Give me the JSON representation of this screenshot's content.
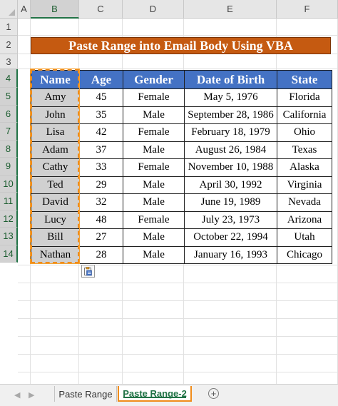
{
  "columns": [
    "A",
    "B",
    "C",
    "D",
    "E",
    "F"
  ],
  "rows": [
    "1",
    "2",
    "3",
    "4",
    "5",
    "6",
    "7",
    "8",
    "9",
    "10",
    "11",
    "12",
    "13",
    "14"
  ],
  "title": "Paste Range into Email Body Using VBA",
  "table": {
    "headers": [
      "Name",
      "Age",
      "Gender",
      "Date of Birth",
      "State"
    ],
    "rows": [
      [
        "Amy",
        "45",
        "Female",
        "May 5, 1976",
        "Florida"
      ],
      [
        "John",
        "35",
        "Male",
        "September 28, 1986",
        "California"
      ],
      [
        "Lisa",
        "42",
        "Female",
        "February 18, 1979",
        "Ohio"
      ],
      [
        "Adam",
        "37",
        "Male",
        "August 26, 1984",
        "Texas"
      ],
      [
        "Cathy",
        "33",
        "Female",
        "November 10, 1988",
        "Alaska"
      ],
      [
        "Ted",
        "29",
        "Male",
        "April 30, 1992",
        "Virginia"
      ],
      [
        "David",
        "32",
        "Male",
        "June 19, 1989",
        "Nevada"
      ],
      [
        "Lucy",
        "48",
        "Female",
        "July 23, 1973",
        "Arizona"
      ],
      [
        "Bill",
        "27",
        "Male",
        "October 22, 1994",
        "Utah"
      ],
      [
        "Nathan",
        "28",
        "Male",
        "January 16, 1993",
        "Chicago"
      ]
    ]
  },
  "sheet_tabs": {
    "tab1": "Paste Range",
    "tab2": "Paste Range-2",
    "active": "Paste Range-2"
  },
  "colors": {
    "title_bg": "#c55a11",
    "header_bg": "#4472c4",
    "name_cell_bg": "#d0d0d0",
    "selection_border": "#f08c1a",
    "excel_green": "#217346"
  },
  "icons": {
    "paste_options": "paste-options-icon",
    "add_sheet": "add-sheet-icon",
    "nav_prev": "nav-left-arrow-icon",
    "nav_next": "nav-right-arrow-icon"
  }
}
